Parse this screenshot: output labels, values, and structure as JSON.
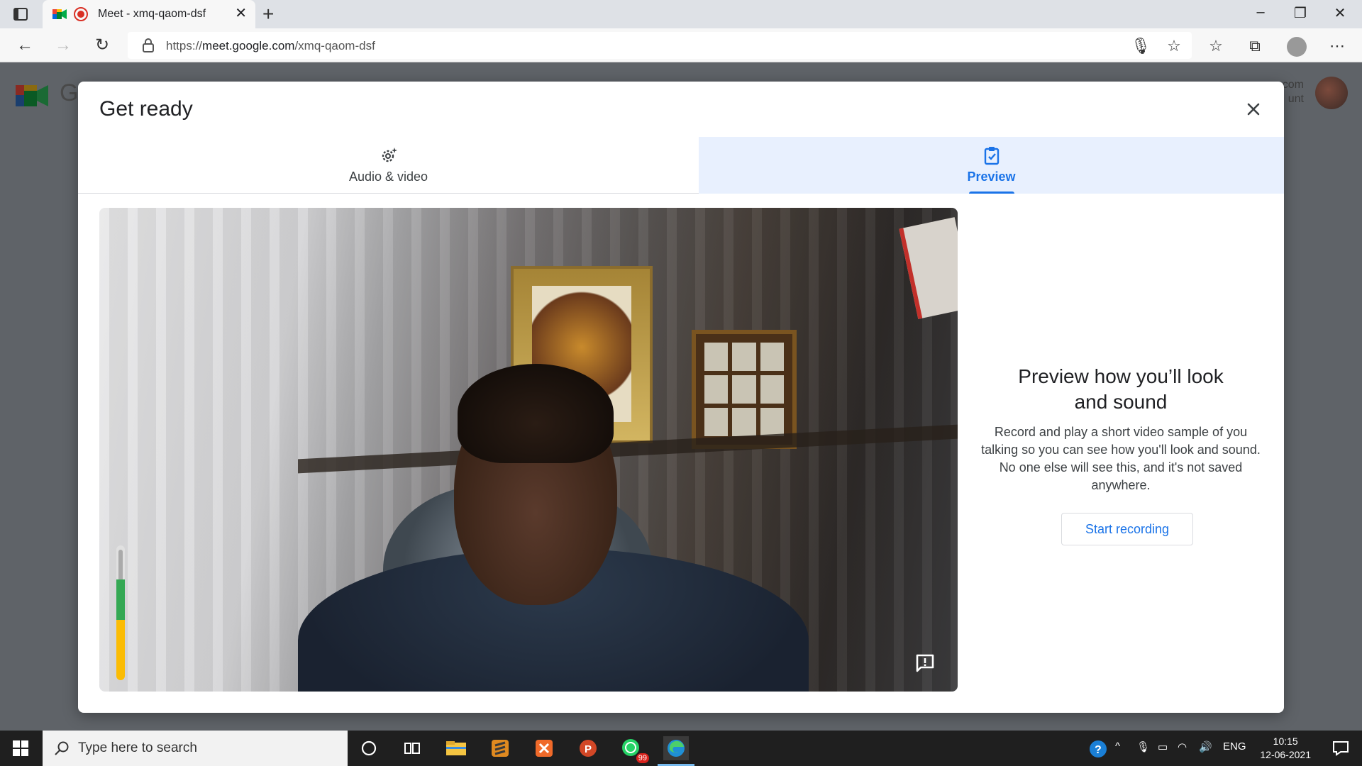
{
  "browser": {
    "tab_title": "Meet - xmq-qaom-dsf",
    "url_prefix": "https://",
    "url_host": "meet.google.com",
    "url_path": "/xmq-qaom-dsf"
  },
  "behind": {
    "brand_letter": "G",
    "account_line1": "com",
    "account_line2": "unt"
  },
  "dialog": {
    "title": "Get ready",
    "tabs": [
      {
        "label": "Audio & video",
        "icon": "settings-gear-icon",
        "selected": false
      },
      {
        "label": "Preview",
        "icon": "clipboard-check-icon",
        "selected": true
      }
    ],
    "mic_level": {
      "green_fraction": 0.3,
      "yellow_fraction": 0.45
    }
  },
  "preview": {
    "title": "Preview how you’ll look and sound",
    "description": "Record and play a short video sample of you talking so you can see how you'll look and sound. No one else will see this, and it's not saved anywhere.",
    "button_label": "Start recording"
  },
  "taskbar": {
    "search_placeholder": "Type here to search",
    "whatsapp_badge": "99",
    "language": "ENG",
    "time": "10:15",
    "date": "12-06-2021"
  },
  "colors": {
    "accent": "#1a73e8",
    "selected_tab_bg": "#e8f0fe",
    "record_red": "#d93025"
  }
}
